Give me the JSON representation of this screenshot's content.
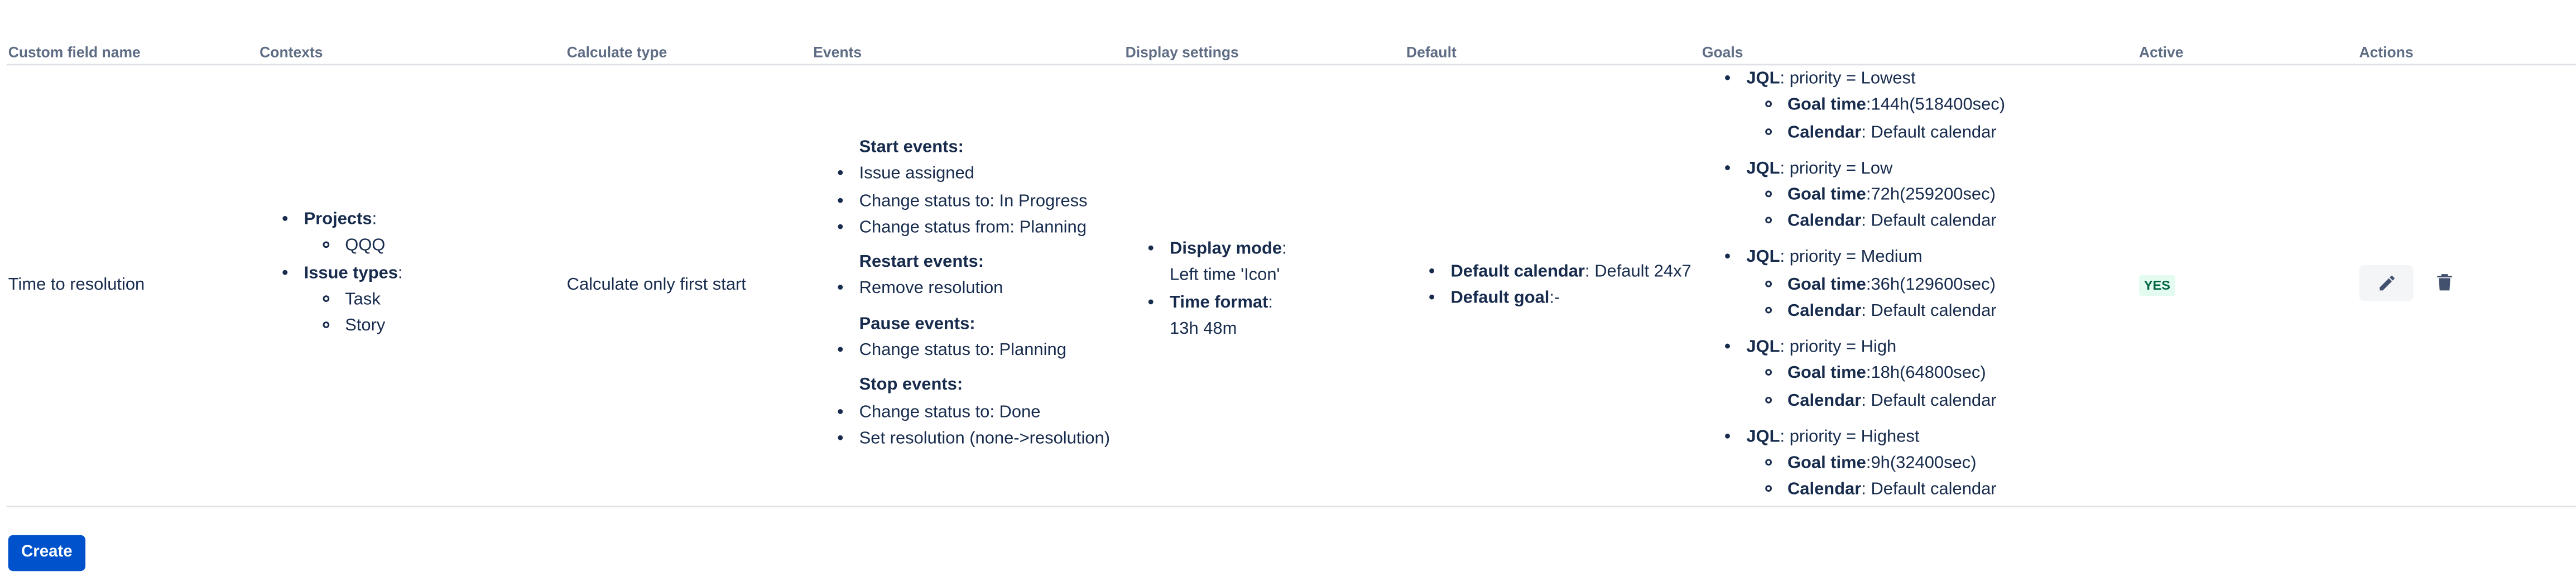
{
  "table": {
    "headers": {
      "custom_field_name": "Custom field name",
      "contexts": "Contexts",
      "calculate_type": "Calculate type",
      "events": "Events",
      "display_settings": "Display settings",
      "default": "Default",
      "goals": "Goals",
      "active": "Active",
      "actions": "Actions"
    },
    "row": {
      "custom_field_name": "Time to resolution",
      "contexts": {
        "projects_label": "Projects",
        "projects": [
          "QQQ"
        ],
        "issue_types_label": "Issue types",
        "issue_types": [
          "Task",
          "Story"
        ]
      },
      "calculate_type": "Calculate only first start",
      "events": {
        "start_label": "Start events",
        "start": [
          "Issue assigned",
          "Change status to: In Progress",
          "Change status from: Planning"
        ],
        "restart_label": "Restart events",
        "restart": [
          "Remove resolution"
        ],
        "pause_label": "Pause events",
        "pause": [
          "Change status to: Planning"
        ],
        "stop_label": "Stop events",
        "stop": [
          "Change status to: Done",
          "Set resolution (none->resolution)"
        ]
      },
      "display_settings": {
        "mode_label": "Display mode",
        "mode_value": "Left time 'Icon'",
        "format_label": "Time format",
        "format_value": "13h 48m"
      },
      "default": {
        "calendar_label": "Default calendar",
        "calendar_value": "Default 24x7",
        "goal_label": "Default goal",
        "goal_value": "-"
      },
      "goals": [
        {
          "jql_label": "JQL",
          "jql": "priority = Lowest",
          "goal_label": "Goal time",
          "goal_time": "144h(518400sec)",
          "calendar_label": "Calendar",
          "calendar": "Default calendar"
        },
        {
          "jql_label": "JQL",
          "jql": "priority = Low",
          "goal_label": "Goal time",
          "goal_time": "72h(259200sec)",
          "calendar_label": "Calendar",
          "calendar": "Default calendar"
        },
        {
          "jql_label": "JQL",
          "jql": "priority = Medium",
          "goal_label": "Goal time",
          "goal_time": "36h(129600sec)",
          "calendar_label": "Calendar",
          "calendar": "Default calendar"
        },
        {
          "jql_label": "JQL",
          "jql": "priority = High",
          "goal_label": "Goal time",
          "goal_time": "18h(64800sec)",
          "calendar_label": "Calendar",
          "calendar": "Default calendar"
        },
        {
          "jql_label": "JQL",
          "jql": "priority = Highest",
          "goal_label": "Goal time",
          "goal_time": "9h(32400sec)",
          "calendar_label": "Calendar",
          "calendar": "Default calendar"
        }
      ],
      "active": "YES",
      "actions": {
        "edit_icon": "pencil-icon",
        "delete_icon": "trash-icon"
      }
    }
  },
  "create_button": "Create",
  "colors": {
    "primary": "#0052cc",
    "text": "#172b4d",
    "header_text": "#5e6c84",
    "active_badge_bg": "#e3fcef",
    "active_badge_text": "#006644"
  }
}
